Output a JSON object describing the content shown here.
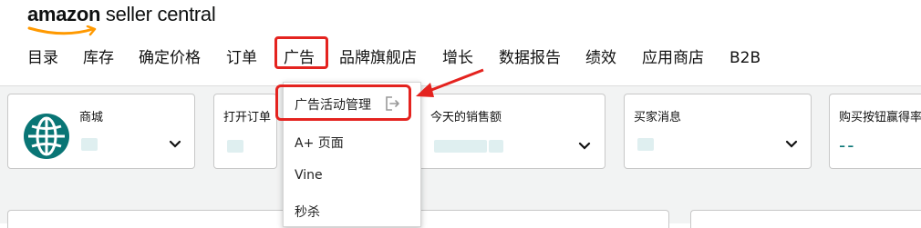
{
  "brand": {
    "amazon": "amazon",
    "rest": " seller central",
    "accent": "#ff9900"
  },
  "nav": {
    "items": [
      "目录",
      "库存",
      "确定价格",
      "订单",
      "广告",
      "品牌旗舰店",
      "增长",
      "数据报告",
      "绩效",
      "应用商店",
      "B2B"
    ],
    "highlighted": "广告"
  },
  "cards": [
    {
      "title": "商城",
      "icon": "globe-icon",
      "has_dropdown": true
    },
    {
      "title": "打开订单",
      "has_dropdown": false
    },
    {
      "title": "今天的销售额",
      "has_dropdown": true
    },
    {
      "title": "买家消息",
      "has_dropdown": true
    },
    {
      "title": "购买按钮赢得率",
      "value": "--"
    }
  ],
  "dropdown": {
    "items": [
      "广告活动管理",
      "A+ 页面",
      "Vine",
      "秒杀"
    ],
    "active_item_icon": "external-link-icon"
  },
  "colors": {
    "annotation_red": "#e4231f",
    "teal": "#097575",
    "background": "#f2f3f3"
  }
}
